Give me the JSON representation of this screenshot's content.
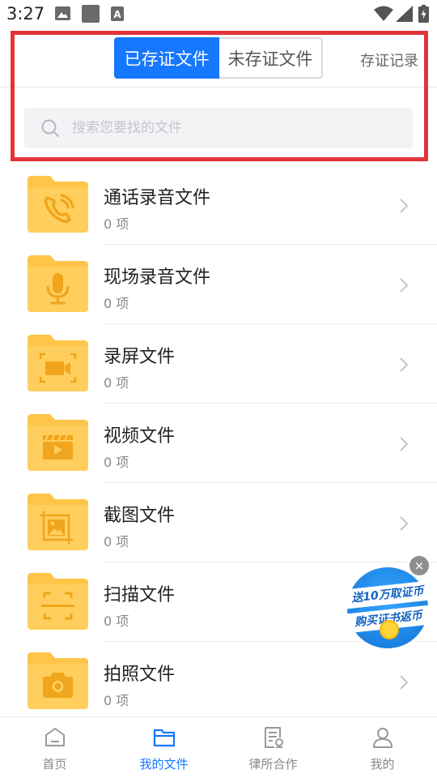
{
  "status_bar": {
    "time": "3:27",
    "a_glyph": "A"
  },
  "header": {
    "tabs": [
      {
        "label": "已存证文件",
        "active": true
      },
      {
        "label": "未存证文件",
        "active": false
      }
    ],
    "record_link": "存证记录"
  },
  "search": {
    "placeholder": "搜索您要找的文件",
    "value": ""
  },
  "files": [
    {
      "title": "通话录音文件",
      "count": "0 项",
      "icon": "phone-icon"
    },
    {
      "title": "现场录音文件",
      "count": "0 项",
      "icon": "microphone-icon"
    },
    {
      "title": "录屏文件",
      "count": "0 项",
      "icon": "screen-record-icon"
    },
    {
      "title": "视频文件",
      "count": "0 项",
      "icon": "video-clapper-icon"
    },
    {
      "title": "截图文件",
      "count": "0 项",
      "icon": "screenshot-icon"
    },
    {
      "title": "扫描文件",
      "count": "0 项",
      "icon": "scan-icon"
    },
    {
      "title": "拍照文件",
      "count": "0 项",
      "icon": "camera-icon"
    }
  ],
  "promo": {
    "line1": "送10万取证币",
    "line2": "购买证书返币",
    "close": "×"
  },
  "tab_bar": [
    {
      "label": "首页",
      "active": false,
      "icon": "home-icon"
    },
    {
      "label": "我的文件",
      "active": true,
      "icon": "folder-icon"
    },
    {
      "label": "律所合作",
      "active": false,
      "icon": "document-stamp-icon"
    },
    {
      "label": "我的",
      "active": false,
      "icon": "person-icon"
    }
  ],
  "colors": {
    "accent": "#1677ff",
    "folder": "#ffc549",
    "folder_icon": "#f0a51c",
    "highlight": "#e3343b"
  }
}
